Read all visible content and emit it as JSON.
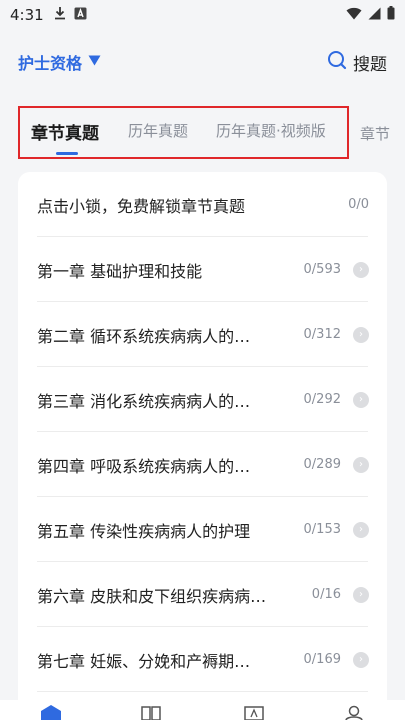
{
  "status_bar": {
    "time": "4:31",
    "icons": [
      "download-icon",
      "a-notification-icon"
    ],
    "right_icons": [
      "wifi-icon",
      "signal-icon",
      "battery-icon"
    ]
  },
  "header": {
    "cert_label": "护士资格",
    "search_label": "搜题",
    "accent_color": "#2f6ae0"
  },
  "tabs": [
    {
      "label": "章节真题",
      "active": true
    },
    {
      "label": "历年真题",
      "active": false
    },
    {
      "label": "历年真题·视频版",
      "active": false
    }
  ],
  "tab_overflow_label": "章节",
  "highlight_color": "#e0272a",
  "chapters": [
    {
      "label": "点击小锁，免费解锁章节真题",
      "count": "0/0",
      "has_arrow": false
    },
    {
      "label": "第一章 基础护理和技能",
      "count": "0/593",
      "has_arrow": true
    },
    {
      "label": "第二章 循环系统疾病病人的…",
      "count": "0/312",
      "has_arrow": true
    },
    {
      "label": "第三章 消化系统疾病病人的…",
      "count": "0/292",
      "has_arrow": true
    },
    {
      "label": "第四章 呼吸系统疾病病人的…",
      "count": "0/289",
      "has_arrow": true
    },
    {
      "label": "第五章 传染性疾病病人的护理",
      "count": "0/153",
      "has_arrow": true
    },
    {
      "label": "第六章 皮肤和皮下组织疾病病…",
      "count": "0/16",
      "has_arrow": true
    },
    {
      "label": "第七章 妊娠、分娩和产褥期…",
      "count": "0/169",
      "has_arrow": true
    }
  ],
  "bottom_nav": [
    "home-icon",
    "book-icon",
    "exam-icon",
    "profile-icon"
  ]
}
